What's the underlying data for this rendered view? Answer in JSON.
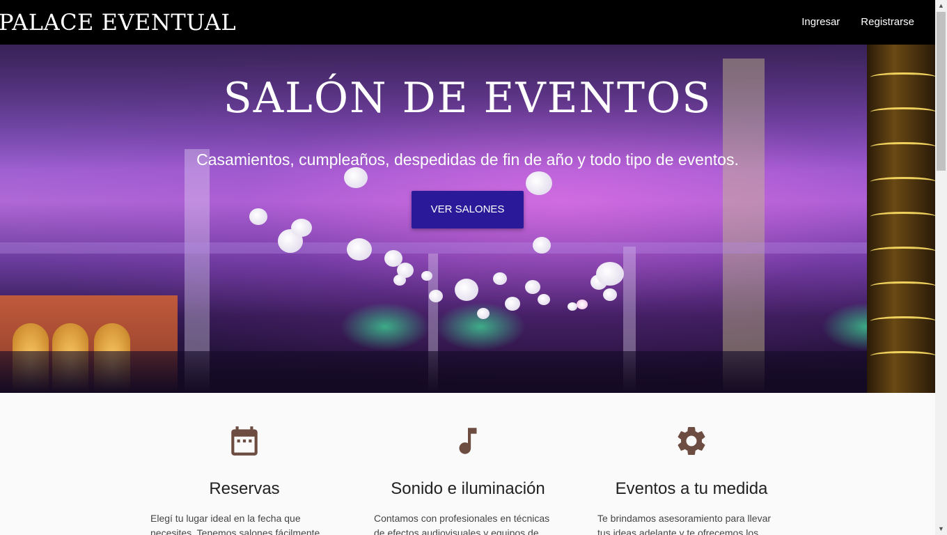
{
  "navbar": {
    "brand": "PALACE EVENTUAL",
    "links": [
      "Ingresar",
      "Registrarse"
    ]
  },
  "hero": {
    "title": "SALÓN DE EVENTOS",
    "subtitle": "Casamientos, cumpleaños, despedidas de fin de año y todo tipo de eventos.",
    "button_label": "VER SALONES"
  },
  "features": [
    {
      "icon": "calendar-icon",
      "title": "Reservas",
      "text": "Elegí tu lugar ideal en la fecha que necesites. Tenemos salones fácilmente"
    },
    {
      "icon": "music-note-icon",
      "title": "Sonido e iluminación",
      "text": "Contamos con profesionales en técnicas de efectos audiovisuales y equipos de"
    },
    {
      "icon": "gear-icon",
      "title": "Eventos a tu medida",
      "text": "Te brindamos asesoramiento para llevar tus ideas adelante y te ofrecemos los"
    }
  ],
  "colors": {
    "navbar_bg": "#000000",
    "button_bg": "#2a1a9a",
    "icon_color": "#6d4c41"
  }
}
